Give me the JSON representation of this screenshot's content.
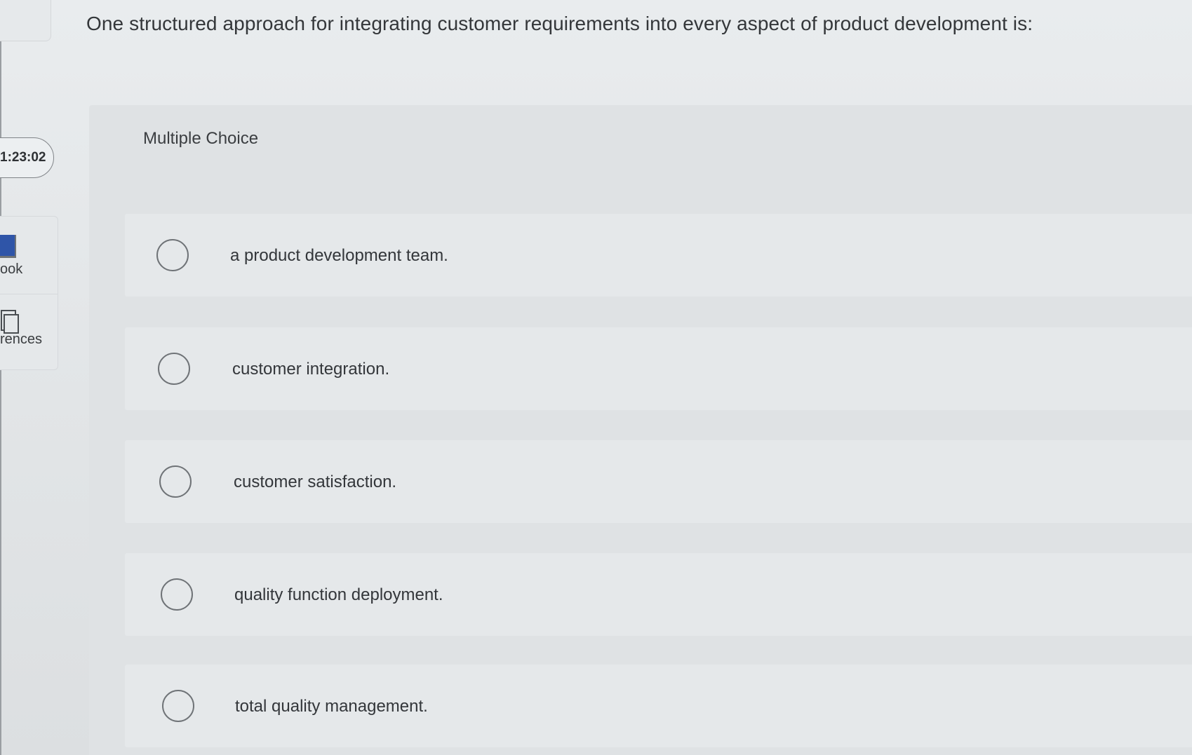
{
  "timer": {
    "value": "1:23:02"
  },
  "sidebar": {
    "items": [
      {
        "label": "ook",
        "icon": "book-icon"
      },
      {
        "label": "rences",
        "icon": "references-icon"
      }
    ]
  },
  "question": {
    "text": "One structured approach for integrating customer requirements into every aspect of product development is:"
  },
  "choices": {
    "type_label": "Multiple Choice",
    "options": [
      {
        "label": "a product development team."
      },
      {
        "label": "customer integration."
      },
      {
        "label": "customer satisfaction."
      },
      {
        "label": "quality function deployment."
      },
      {
        "label": "total quality management."
      }
    ]
  },
  "colors": {
    "background": "#e6e9eb",
    "panel": "#dfe2e4",
    "option_background": "#e5e8ea",
    "radio_border": "#6f7377",
    "book_icon_accent": "#2f55a8"
  }
}
